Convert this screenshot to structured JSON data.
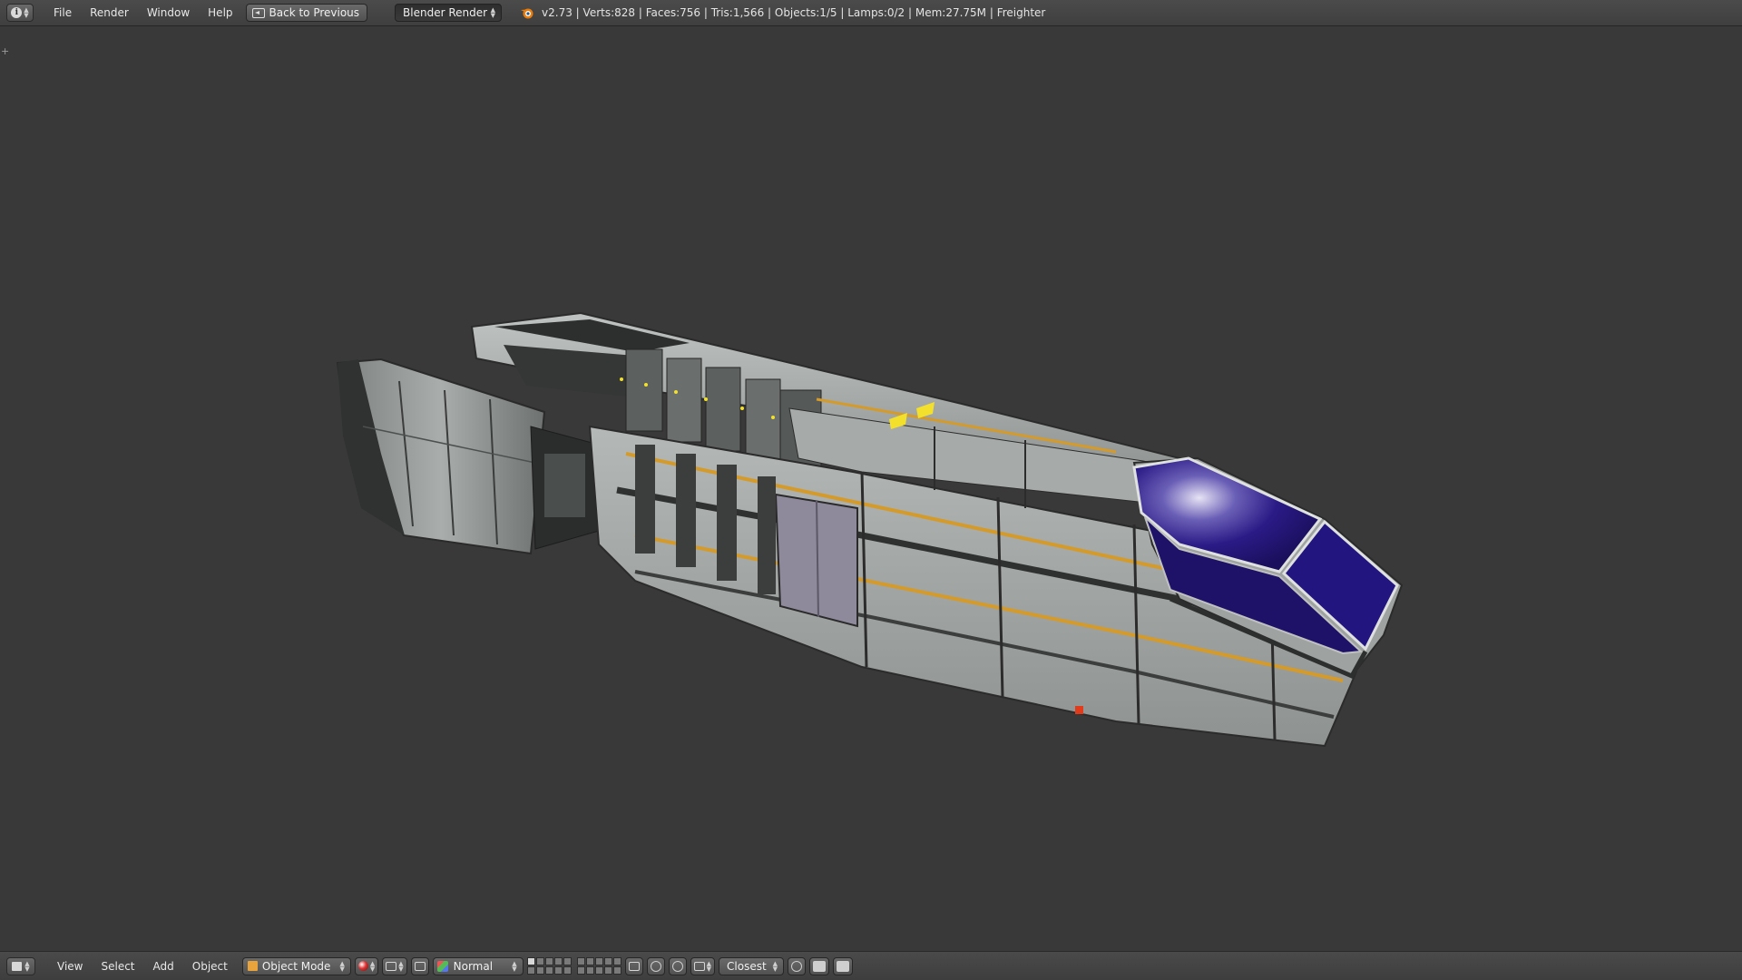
{
  "top_header": {
    "menus": [
      "File",
      "Render",
      "Window",
      "Help"
    ],
    "back_button_label": "Back to Previous",
    "render_engine": "Blender Render",
    "stats": "v2.73 | Verts:828 | Faces:756 | Tris:1,566 | Objects:1/5 | Lamps:0/2 | Mem:27.75M | Freighter"
  },
  "viewport": {
    "corner_marker": "+",
    "object_name": "Freighter"
  },
  "bottom_header": {
    "menus": [
      "View",
      "Select",
      "Add",
      "Object"
    ],
    "mode": "Object Mode",
    "orientation": "Normal",
    "snap_target": "Closest",
    "layers_first_block": [
      true,
      false,
      false,
      false,
      false,
      false,
      false,
      false,
      false,
      false
    ],
    "layers_second_block": [
      false,
      false,
      false,
      false,
      false,
      false,
      false,
      false,
      false,
      false
    ]
  },
  "colors": {
    "background": "#393939",
    "header": "#434343",
    "hull": "#a9adab",
    "stripe": "#d49b2a",
    "cockpit": "#23147a",
    "accent_light": "#f2e02c",
    "beacon": "#e13b1c"
  }
}
